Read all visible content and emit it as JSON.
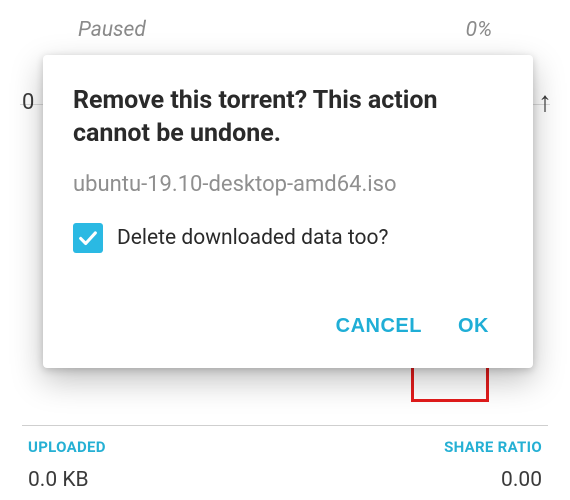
{
  "background": {
    "status": "Paused",
    "progress": "0%",
    "fragmentLeft": "0",
    "fragmentRight": "↑",
    "uploadedLabel": "UPLOADED",
    "uploadedValue": "0.0 KB",
    "ratioLabel": "SHARE RATIO",
    "ratioValue": "0.00"
  },
  "dialog": {
    "title": "Remove this torrent? This action cannot be undone.",
    "filename": "ubuntu-19.10-desktop-amd64.iso",
    "checkboxLabel": "Delete downloaded data too?",
    "checkboxChecked": true,
    "cancelLabel": "CANCEL",
    "okLabel": "OK"
  }
}
